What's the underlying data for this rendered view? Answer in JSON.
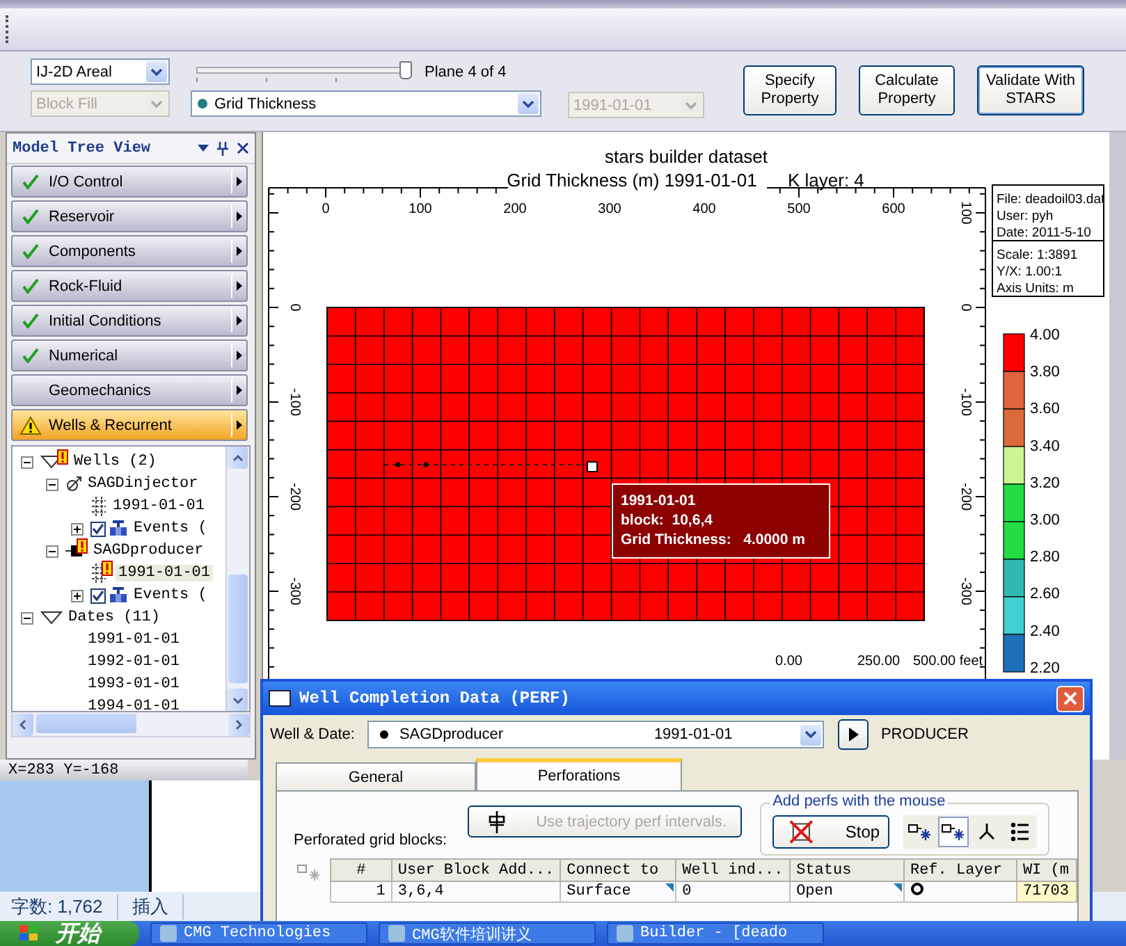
{
  "view_controls": {
    "view_mode": "IJ-2D Areal",
    "fill_mode": {
      "value": "Block Fill",
      "disabled": true
    },
    "plane_slider": {
      "level": 1
    },
    "plane_label": "Plane 4 of 4",
    "property": "Grid Thickness",
    "date": {
      "value": "1991-01-01",
      "disabled": true
    }
  },
  "buttons": [
    "Specify Property",
    "Calculate Property",
    "Validate With STARS"
  ],
  "model_tree": {
    "title": "Model Tree View",
    "sections": [
      {
        "label": "I/O Control",
        "kind": "done",
        "selected": false
      },
      {
        "label": "Reservoir",
        "kind": "done",
        "selected": false
      },
      {
        "label": "Components",
        "kind": "done",
        "selected": false
      },
      {
        "label": "Rock-Fluid",
        "kind": "done",
        "selected": false
      },
      {
        "label": "Initial Conditions",
        "kind": "done",
        "selected": false
      },
      {
        "label": "Numerical",
        "kind": "done",
        "selected": false
      },
      {
        "label": "Geomechanics",
        "kind": "plain",
        "selected": false
      },
      {
        "label": "Wells & Recurrent",
        "kind": "warning",
        "selected": true
      }
    ],
    "tree": [
      {
        "label": "Wells (2)",
        "kind": "group",
        "warning": true,
        "expanded": true,
        "selected": false,
        "children": [
          {
            "label": "SAGDinjector",
            "kind": "injector",
            "warning": false,
            "expanded": true,
            "selected": false,
            "children": [
              {
                "label": "1991-01-01",
                "kind": "perf",
                "warning": false,
                "selected": false
              },
              {
                "label": "Events (",
                "kind": "events",
                "expanded": false,
                "checked": true,
                "selected": false
              }
            ]
          },
          {
            "label": "SAGDproducer",
            "kind": "producer",
            "warning": true,
            "expanded": true,
            "selected": false,
            "children": [
              {
                "label": "1991-01-01",
                "kind": "perf",
                "warning": true,
                "selected": true
              },
              {
                "label": "Events (",
                "kind": "events",
                "expanded": false,
                "checked": true,
                "selected": false
              }
            ]
          }
        ]
      },
      {
        "label": "Dates (11)",
        "kind": "group",
        "warning": false,
        "expanded": true,
        "selected": false,
        "children": [
          {
            "label": "1991-01-01",
            "kind": "date",
            "selected": false
          },
          {
            "label": "1992-01-01",
            "kind": "date",
            "selected": false
          },
          {
            "label": "1993-01-01",
            "kind": "date",
            "selected": false
          },
          {
            "label": "1994-01-01",
            "kind": "date",
            "selected": false
          }
        ]
      }
    ]
  },
  "coords": "X=283 Y=-168",
  "plot": {
    "title": "stars builder dataset",
    "subtitle": "Grid Thickness (m) 1991-01-01",
    "layer": "K layer: 4",
    "top_ticks": [
      "0",
      "100",
      "200",
      "300",
      "400",
      "500",
      "600"
    ],
    "left_ticks": [
      "0",
      "-100",
      "-200",
      "-300"
    ],
    "right_ticks": [
      "100",
      "0",
      "-100",
      "-200",
      "-300"
    ],
    "info": [
      "File: deadoil03.dat",
      "User:  pyh",
      "Date: 2011-5-10"
    ],
    "scale_info": [
      "Scale: 1:3891",
      "Y/X: 1.00:1",
      "Axis Units: m"
    ],
    "scale_bar": [
      "0.00",
      "250.00",
      "500.00 feet"
    ],
    "legend": {
      "labels": [
        "4.00",
        "3.80",
        "3.60",
        "3.40",
        "3.20",
        "3.00",
        "2.80",
        "2.60",
        "2.40",
        "2.20"
      ],
      "bands": [
        {
          "color": "#ff0000"
        },
        {
          "color": "#e0643c"
        },
        {
          "color": "#dd6a3a"
        },
        {
          "color": "#ccf590"
        },
        {
          "color": "#22dd44"
        },
        {
          "color": "#22dd44"
        },
        {
          "color": "#30b8b0"
        },
        {
          "color": "#40d0d0"
        },
        {
          "color": "#1e70b8"
        }
      ]
    },
    "tooltip": [
      "1991-01-01",
      "block:  10,6,4",
      "Grid Thickness:   4.0000 m"
    ]
  },
  "dialog": {
    "title": "Well Completion Data (PERF)",
    "well_label": "Well & Date:",
    "well": "SAGDproducer",
    "date": "1991-01-01",
    "well_type": "PRODUCER",
    "tabs": [
      {
        "label": "General",
        "selected": false
      },
      {
        "label": "Perforations",
        "selected": true
      }
    ],
    "blocks_label": "Perforated grid blocks:",
    "trajectory_button": {
      "label": "Use trajectory perf intervals.",
      "disabled": true
    },
    "mouse_group": {
      "title": "Add perfs with the mouse",
      "stop": "Stop",
      "tools": [
        {
          "kind": "add",
          "selected": false
        },
        {
          "kind": "add",
          "selected": true
        },
        {
          "kind": "branch",
          "selected": false
        },
        {
          "kind": "list",
          "selected": false
        }
      ]
    },
    "table": {
      "columns": [
        "#",
        "User Block Add...",
        "Connect to",
        "Well ind...",
        "Status",
        "Ref. Layer",
        "WI  (m"
      ],
      "rows": [
        {
          "number": "1",
          "block": "3,6,4",
          "connect": "Surface",
          "well_index": "0",
          "status": "Open",
          "wi": "71703"
        }
      ]
    }
  },
  "word_status": {
    "word_count": "字数: 1,762",
    "mode": "插入"
  },
  "taskbar": {
    "start": "开始",
    "tasks": [
      "CMG Technologies",
      "CMG软件培训讲义",
      "Builder - [deado"
    ]
  }
}
